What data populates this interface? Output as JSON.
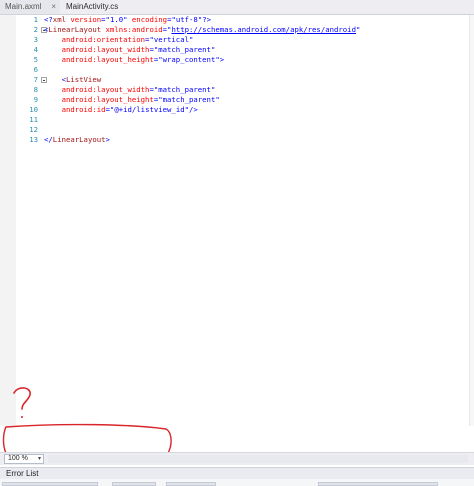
{
  "tabs": [
    {
      "label": "Main.axml",
      "close": "×"
    },
    {
      "label": "MainActivity.cs",
      "close": "×"
    }
  ],
  "code_lines": [
    {
      "num": "1",
      "parts": [
        [
          "cb",
          "<?"
        ],
        [
          "tag",
          "xml"
        ],
        [
          "attr",
          " version"
        ],
        [
          "cb",
          "="
        ],
        [
          "val",
          "\"1.0\""
        ],
        [
          "attr",
          " encoding"
        ],
        [
          "cb",
          "="
        ],
        [
          "val",
          "\"utf-8\""
        ],
        [
          "cb",
          "?>"
        ]
      ]
    },
    {
      "num": "2",
      "parts": [
        [
          "cb",
          "<"
        ],
        [
          "tag",
          "LinearLayout"
        ],
        [
          "attr",
          " xmlns:android"
        ],
        [
          "cb",
          "="
        ],
        [
          "val",
          "\""
        ],
        [
          "url",
          "http://schemas.android.com/apk/res/android"
        ],
        [
          "val",
          "\""
        ]
      ]
    },
    {
      "num": "3",
      "parts": [
        [
          "attr",
          "    android:orientation"
        ],
        [
          "cb",
          "="
        ],
        [
          "val",
          "\"vertical\""
        ]
      ]
    },
    {
      "num": "4",
      "parts": [
        [
          "attr",
          "    android:layout_width"
        ],
        [
          "cb",
          "="
        ],
        [
          "val",
          "\"match_parent\""
        ]
      ]
    },
    {
      "num": "5",
      "parts": [
        [
          "attr",
          "    android:layout_height"
        ],
        [
          "cb",
          "="
        ],
        [
          "val",
          "\"wrap_content\""
        ],
        [
          "cb",
          ">"
        ]
      ]
    },
    {
      "num": "6",
      "parts": []
    },
    {
      "num": "7",
      "parts": [
        [
          "cb",
          "    <"
        ],
        [
          "tag",
          "ListView"
        ]
      ]
    },
    {
      "num": "8",
      "parts": [
        [
          "attr",
          "    android:layout_width"
        ],
        [
          "cb",
          "="
        ],
        [
          "val",
          "\"match_parent\""
        ]
      ]
    },
    {
      "num": "9",
      "parts": [
        [
          "attr",
          "    android:layout_height"
        ],
        [
          "cb",
          "="
        ],
        [
          "val",
          "\"match_parent\""
        ]
      ]
    },
    {
      "num": "10",
      "parts": [
        [
          "attr",
          "    android:id"
        ],
        [
          "cb",
          "="
        ],
        [
          "val",
          "\"@+id/listview_id\""
        ],
        [
          "cb",
          "/>"
        ]
      ]
    },
    {
      "num": "11",
      "parts": []
    },
    {
      "num": "12",
      "parts": []
    },
    {
      "num": "13",
      "parts": [
        [
          "cb",
          "</"
        ],
        [
          "tag",
          "LinearLayout"
        ],
        [
          "cb",
          ">"
        ]
      ]
    }
  ],
  "zoom": {
    "value": "100 %",
    "arrow": "▾"
  },
  "panel": {
    "title": "Error List"
  },
  "annotation": {
    "mark": "?",
    "color": "#d9252a"
  }
}
